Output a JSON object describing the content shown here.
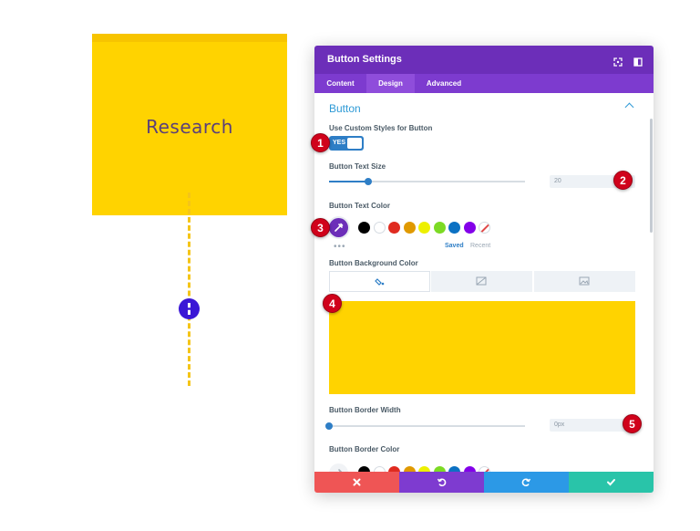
{
  "note": {
    "text": "Research"
  },
  "panel": {
    "title": "Button Settings",
    "tabs": [
      {
        "label": "Content"
      },
      {
        "label": "Design"
      },
      {
        "label": "Advanced"
      }
    ],
    "active_tab": "Design",
    "section_title": "Button",
    "custom_styles": {
      "label": "Use Custom Styles for Button",
      "value": "YES",
      "on": true
    },
    "text_size": {
      "label": "Button Text Size",
      "value": "20",
      "fraction": 0.2
    },
    "text_color": {
      "label": "Button Text Color",
      "saved_label": "Saved",
      "recent_label": "Recent",
      "more": "•••",
      "selected": "#6c2eb9",
      "swatches": [
        "#000000",
        "#ffffff",
        "#e02b20",
        "#e09900",
        "#edf000",
        "#7cda24",
        "#0c71c3",
        "#8300e9"
      ]
    },
    "background_color": {
      "label": "Button Background Color",
      "value": "#ffd300"
    },
    "border_width": {
      "label": "Button Border Width",
      "value": "0px",
      "fraction": 0.0
    },
    "border_color": {
      "label": "Button Border Color",
      "swatches": [
        "#000000",
        "#ffffff",
        "#e02b20",
        "#e09900",
        "#edf000",
        "#7cda24",
        "#0c71c3",
        "#8300e9"
      ]
    }
  },
  "markers": [
    "1",
    "2",
    "3",
    "4",
    "5"
  ],
  "colors": {
    "accent_purple": "#6c2eb9",
    "accent_blue": "#2e9ad6",
    "marker_red": "#d0021b",
    "note_yellow": "#ffd300"
  }
}
